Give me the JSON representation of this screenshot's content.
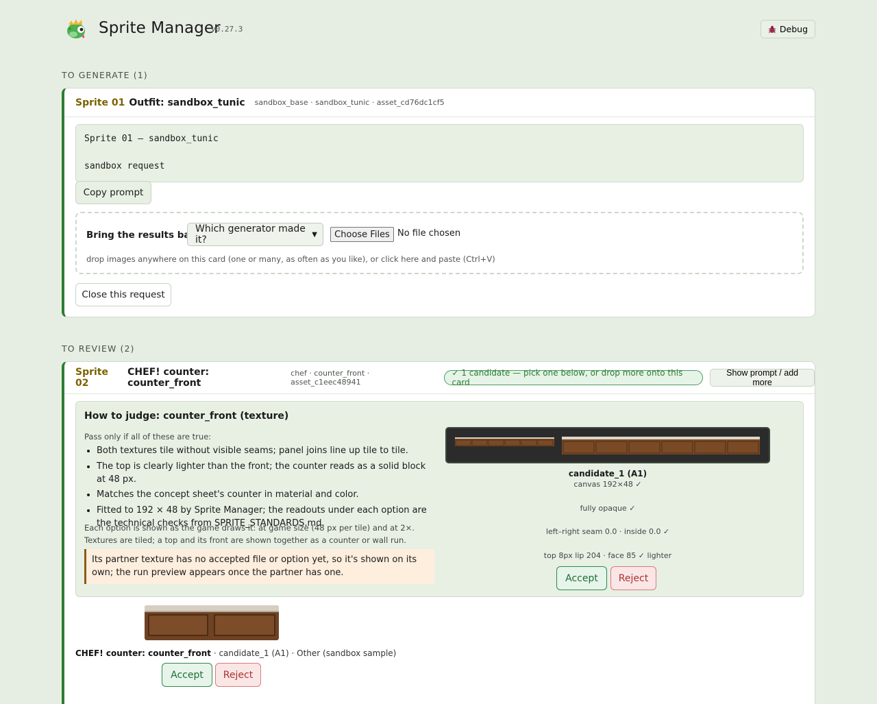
{
  "app": {
    "title": "Sprite Manager",
    "version": "v0.27.3",
    "debug_label": "Debug"
  },
  "sections": {
    "generate": "TO GENERATE (1)",
    "review": "TO REVIEW (2)"
  },
  "generate_card": {
    "sprite_num": "Sprite 01",
    "name": "Outfit: sandbox_tunic",
    "meta": "sandbox_base · sandbox_tunic · asset_cd76dc1cf5",
    "prompt_line1": "Sprite 01 — sandbox_tunic",
    "prompt_line2": "sandbox request",
    "copy_label": "Copy prompt",
    "bring_label": "Bring the results back:",
    "generator_select": "Which generator made it?",
    "choose_files": "Choose Files",
    "file_status": "No file chosen",
    "drop_hint": "drop images anywhere on this card (one or many, as often as you like), or click here and paste (Ctrl+V)",
    "close_label": "Close this request"
  },
  "review_card": {
    "sprite_num": "Sprite 02",
    "name": "CHEF! counter: counter_front",
    "meta": "chef · counter_front · asset_c1eec48941",
    "pill": "✓ 1 candidate — pick one below, or drop more onto this card",
    "show_prompt": "Show prompt / add more",
    "judge_title": "How to judge: counter_front (texture)",
    "pass_line": "Pass only if all of these are true:",
    "rules": [
      "Both textures tile without visible seams; panel joins line up tile to tile.",
      "The top is clearly lighter than the front; the counter reads as a solid block at 48 px.",
      "Matches the concept sheet's counter in material and color.",
      "Fitted to 192 × 48 by Sprite Manager; the readouts under each option are the technical checks from SPRITE_STANDARDS.md."
    ],
    "shown_note": "Each option is shown as the game draws it: at game size (48 px per tile) and at 2×. Textures are tiled; a top and its front are shown together as a counter or wall run.",
    "partner_note": "Its partner texture has no accepted file or option yet, so it's shown on its own; the run preview appears once the partner has one.",
    "candidate": {
      "name": "candidate_1 (A1)",
      "canvas": "canvas 192×48 ✓",
      "opaque": "fully opaque ✓",
      "seam": "left–right seam 0.0 · inside 0.0 ✓",
      "lip": "top 8px lip 204 · face 85 ✓ lighter"
    },
    "accept_label": "Accept",
    "reject_label": "Reject",
    "sample_title": "CHEF! counter: counter_front",
    "sample_meta": " · candidate_1 (A1) · Other (sandbox sample)"
  },
  "colors": {
    "accent_green": "#2e7d32",
    "sprite_num": "#7a6200",
    "wood": "#7a4a26"
  },
  "icons": {
    "logo": "dragon-logo-icon",
    "debug": "bug-icon",
    "select": "chevron-down-icon"
  }
}
